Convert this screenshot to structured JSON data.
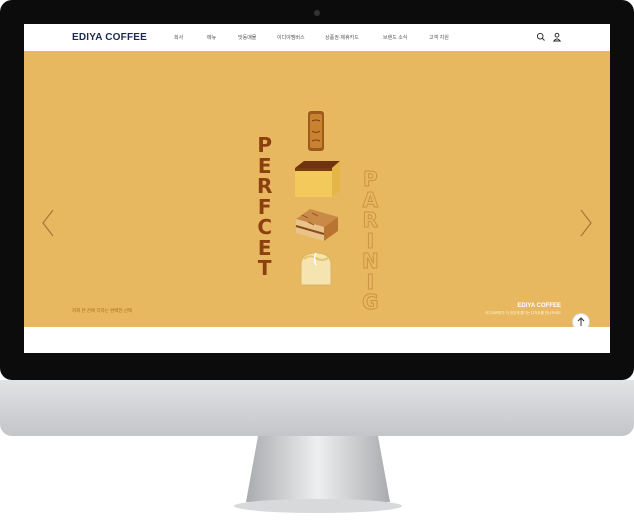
{
  "site": {
    "logo_text": "EDIYA COFFEE",
    "nav": [
      "회사",
      "메뉴",
      "맛동매물",
      "이디야멤버스",
      "상품권·제휴카드",
      "브랜드 소식",
      "고객 지원"
    ],
    "icons": [
      "search-icon",
      "user-icon"
    ]
  },
  "hero": {
    "vertical_word_1": [
      "P",
      "E",
      "R",
      "F",
      "C",
      "E",
      "T"
    ],
    "vertical_word_2": [
      "P",
      "A",
      "R",
      "I",
      "N",
      "I",
      "G"
    ],
    "tagline": "커피 한 잔에 더하는 완벽한 선택",
    "brand_title": "EDIYA COFFEE",
    "brand_subtitle": "이디야커피가 더 맛있게 즐기는 디저트를 만나보세요",
    "products": [
      "pound-cake",
      "castella",
      "layer-cake",
      "bread"
    ],
    "colors": {
      "background": "#e8b860",
      "word_primary": "#8c4010",
      "word_outline": "#c79545"
    }
  }
}
